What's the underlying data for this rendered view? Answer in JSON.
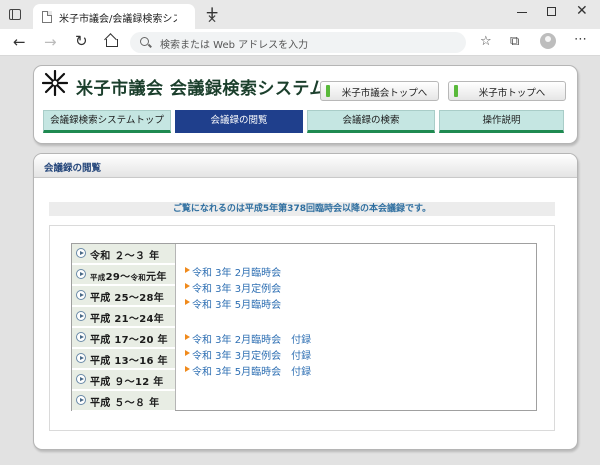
{
  "browser": {
    "tab_title": "米子市議会/会議録検索システム",
    "address_placeholder": "検索または Web アドレスを入力",
    "icons": [
      "tab-actions-icon",
      "close-icon",
      "new-tab-icon",
      "back-icon",
      "forward-icon",
      "reload-icon",
      "home-icon",
      "search-icon",
      "favorite-icon",
      "collections-icon",
      "profile-icon",
      "more-icon"
    ]
  },
  "header": {
    "title": "米子市議会 会議録検索システム",
    "links": [
      {
        "label": "米子市議会トップへ"
      },
      {
        "label": "米子市トップへ"
      }
    ]
  },
  "menu": [
    {
      "label": "会議録検索システムトップ",
      "active": false
    },
    {
      "label": "会議録の閲覧",
      "active": true
    },
    {
      "label": "会議録の検索",
      "active": false
    },
    {
      "label": "操作説明",
      "active": false
    }
  ],
  "content": {
    "panel_title": "会議録の閲覧",
    "notice": "ご覧になれるのは平成5年第378回臨時会以降の本会議録です。",
    "eras": [
      {
        "label": "令和 ２～３ 年"
      },
      {
        "small1": "平成",
        "mid": "29～",
        "small2": "令和",
        "tail": "元年"
      },
      {
        "label": "平成 25～28年"
      },
      {
        "label": "平成 21～24年"
      },
      {
        "label": "平成 17～20 年"
      },
      {
        "label": "平成 13～16 年"
      },
      {
        "label": "平成 ９～12 年"
      },
      {
        "label": "平成 ５～８ 年"
      }
    ],
    "sessions": [
      {
        "label": "令和 3年 2月臨時会"
      },
      {
        "label": "令和 3年 3月定例会"
      },
      {
        "label": "令和 3年 5月臨時会"
      },
      {
        "label": "令和 3年 2月臨時会　付録"
      },
      {
        "label": "令和 3年 3月定例会　付録"
      },
      {
        "label": "令和 3年 5月臨時会　付録"
      }
    ]
  }
}
